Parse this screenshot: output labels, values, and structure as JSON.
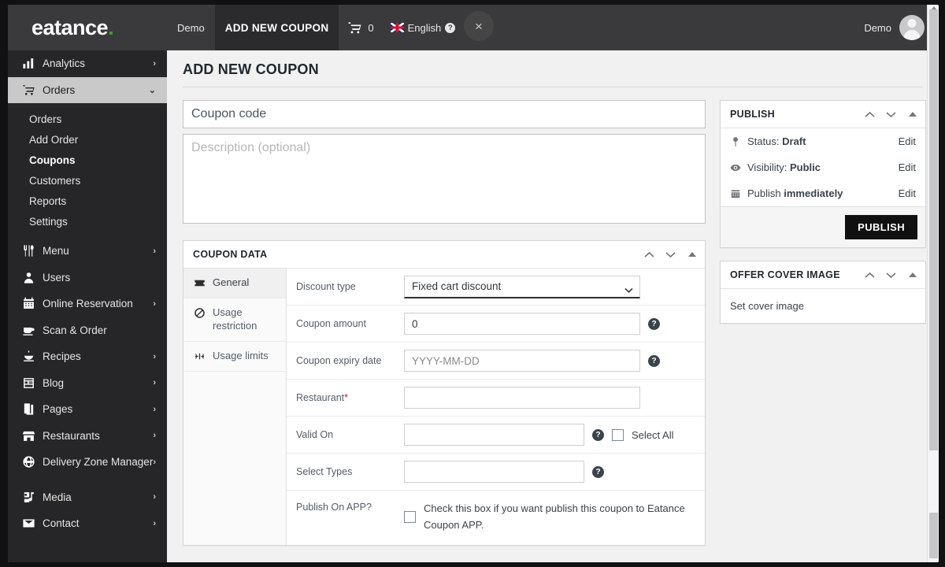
{
  "brand": {
    "name": "eatance",
    "dot": "."
  },
  "topnav": {
    "items": [
      {
        "label": "Demo",
        "active": false
      },
      {
        "label": "ADD NEW COUPON",
        "active": true
      }
    ],
    "cart_count": "0",
    "language": "English",
    "help_icon": "?",
    "user_name": "Demo",
    "close_icon": "×"
  },
  "sidebar": {
    "items": [
      {
        "label": "Analytics",
        "icon": "bar-chart-icon",
        "chevron": "›",
        "active": false
      },
      {
        "label": "Orders",
        "icon": "cart-icon",
        "chevron": "⌄",
        "active": true
      }
    ],
    "sub_items": [
      {
        "label": "Orders",
        "current": false
      },
      {
        "label": "Add Order",
        "current": false
      },
      {
        "label": "Coupons",
        "current": true
      },
      {
        "label": "Customers",
        "current": false
      },
      {
        "label": "Reports",
        "current": false
      },
      {
        "label": "Settings",
        "current": false
      }
    ],
    "items2": [
      {
        "label": "Menu",
        "icon": "cutlery-icon",
        "chevron": "›"
      },
      {
        "label": "Users",
        "icon": "user-icon",
        "chevron": ""
      },
      {
        "label": "Online Reservation",
        "icon": "calendar-icon",
        "chevron": "›"
      },
      {
        "label": "Scan & Order",
        "icon": "cup-icon",
        "chevron": ""
      },
      {
        "label": "Recipes",
        "icon": "recipe-icon",
        "chevron": "›"
      },
      {
        "label": "Blog",
        "icon": "blog-icon",
        "chevron": "›"
      },
      {
        "label": "Pages",
        "icon": "pages-icon",
        "chevron": "›"
      },
      {
        "label": "Restaurants",
        "icon": "store-icon",
        "chevron": "›"
      },
      {
        "label": "Delivery Zone Manager",
        "icon": "globe-icon",
        "chevron": "›"
      }
    ],
    "items3": [
      {
        "label": "Media",
        "icon": "media-icon",
        "chevron": "›"
      },
      {
        "label": "Contact",
        "icon": "envelope-icon",
        "chevron": "›"
      }
    ]
  },
  "main": {
    "page_title": "ADD NEW COUPON",
    "coupon_code_placeholder": "Coupon code",
    "coupon_code_value": "",
    "description_placeholder": "Description (optional)",
    "description_value": ""
  },
  "coupon_data": {
    "panel_title": "COUPON DATA",
    "tabs": [
      {
        "label": "General",
        "icon": "ticket-icon",
        "active": true
      },
      {
        "label": "Usage restriction",
        "icon": "ban-icon",
        "active": false
      },
      {
        "label": "Usage limits",
        "icon": "limits-icon",
        "active": false
      }
    ],
    "fields": {
      "discount_type_label": "Discount type",
      "discount_type_value": "Fixed cart discount",
      "discount_type_options": [
        "Fixed cart discount"
      ],
      "coupon_amount_label": "Coupon amount",
      "coupon_amount_value": "0",
      "expiry_label": "Coupon expiry date",
      "expiry_placeholder": "YYYY-MM-DD",
      "expiry_value": "",
      "restaurant_label": "Restaurant",
      "restaurant_required": "*",
      "restaurant_value": "",
      "valid_on_label": "Valid On",
      "valid_on_value": "",
      "select_all_label": "Select All",
      "select_types_label": "Select Types",
      "select_types_value": "",
      "publish_app_label": "Publish On APP?",
      "publish_app_text": "Check this box if you want publish this coupon to Eatance Coupon APP."
    },
    "help_icon": "?"
  },
  "publish_panel": {
    "title": "PUBLISH",
    "status_label": "Status:",
    "status_value": "Draft",
    "visibility_label": "Visibility:",
    "visibility_value": "Public",
    "publish_label": "Publish",
    "publish_value": "immediately",
    "edit_label": "Edit",
    "button_label": "PUBLISH"
  },
  "cover_panel": {
    "title": "OFFER COVER IMAGE",
    "link_label": "Set cover image"
  },
  "colors": {
    "topbar": "#3a3a3c",
    "sidebar": "#262628",
    "accent_green": "#3aa331",
    "content_bg": "#f1f1f1",
    "publish_button": "#101010"
  }
}
